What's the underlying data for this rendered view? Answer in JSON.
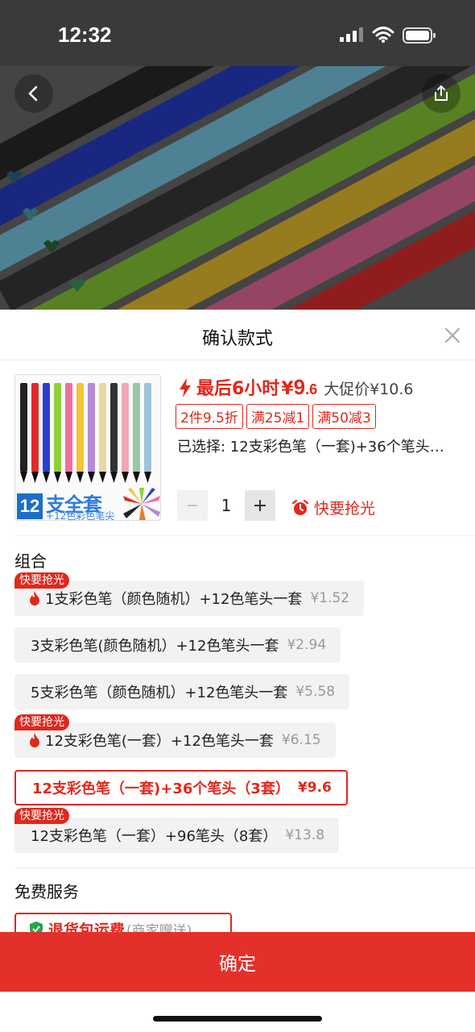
{
  "status_bar": {
    "time": "12:32"
  },
  "sheet": {
    "title": "确认款式",
    "product": {
      "thumb_badge": "12",
      "thumb_set_text": "支全套",
      "thumb_sub_text": "+12色彩色笔尖",
      "countdown_text": "最后6小时",
      "price_symbol": "¥",
      "price_int": "9",
      "price_dec": ".6",
      "promo_price": "大促价¥10.6",
      "coupons": [
        "2件9.5折",
        "满25减1",
        "满50减3"
      ],
      "selected_text": "已选择: 12支彩色笔（一套)+36个笔头…",
      "quantity": "1",
      "hurry_text": "快要抢光"
    },
    "combo_section_title": "组合",
    "options": [
      {
        "tag": "快要抢光",
        "hot": true,
        "label": "1支彩色笔（颜色随机）+12色笔头一套",
        "price": "¥1.52",
        "selected": false
      },
      {
        "tag": "",
        "hot": false,
        "label": "3支彩色笔(颜色随机）+12色笔头一套",
        "price": "¥2.94",
        "selected": false
      },
      {
        "tag": "",
        "hot": false,
        "label": "5支彩色笔（颜色随机）+12色笔头一套",
        "price": "¥5.58",
        "selected": false
      },
      {
        "tag": "快要抢光",
        "hot": true,
        "label": "12支彩色笔(一套）+12色笔头一套",
        "price": "¥6.15",
        "selected": false
      },
      {
        "tag": "",
        "hot": false,
        "label": "12支彩色笔（一套)+36个笔头（3套）",
        "price": "¥9.6",
        "selected": true
      },
      {
        "tag": "快要抢光",
        "hot": false,
        "label": "12支彩色笔（一套）+96笔头（8套）",
        "price": "¥13.8",
        "selected": false
      }
    ],
    "service_section_title": "免费服务",
    "service": {
      "label": "退货包运费",
      "note": "(商家赠送)"
    },
    "confirm_label": "确定"
  },
  "colors": {
    "accent": "#e0281d",
    "confirm_bg": "#e3302a"
  },
  "icons": {
    "back": "chevron-left-icon",
    "share": "share-icon",
    "close": "close-icon",
    "bolt": "lightning-icon",
    "alarm": "alarm-clock-icon",
    "fire": "fire-icon",
    "shield": "shield-check-icon"
  }
}
